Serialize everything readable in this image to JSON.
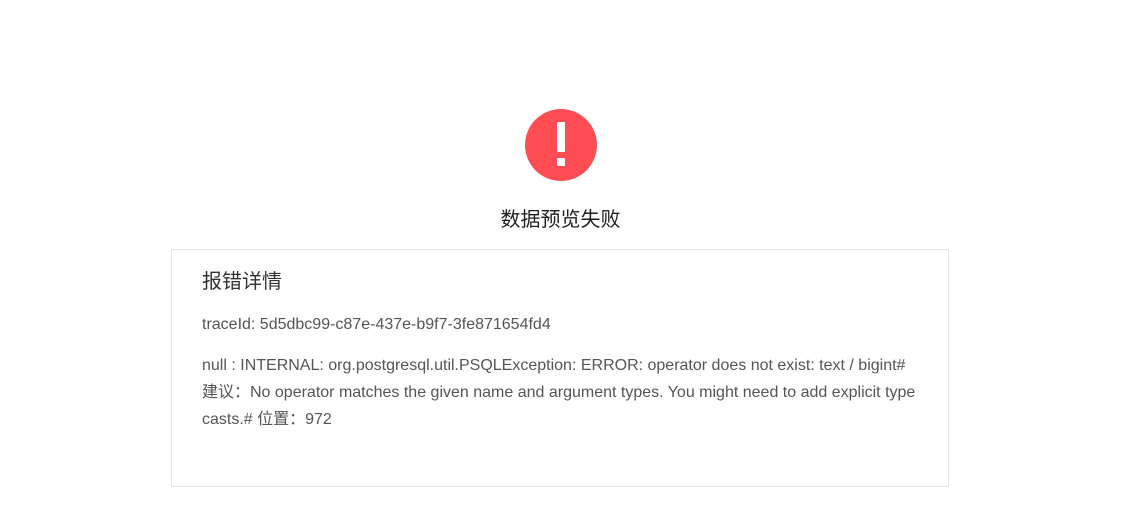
{
  "icon": {
    "name": "exclamation-icon",
    "color": "#ff4d54"
  },
  "title": "数据预览失败",
  "details": {
    "heading": "报错详情",
    "trace_id": "traceId: 5d5dbc99-c87e-437e-b9f7-3fe871654fd4",
    "message": "null : INTERNAL: org.postgresql.util.PSQLException: ERROR: operator does not exist: text / bigint# 建议：No operator matches the given name and argument types. You might need to add explicit type casts.# 位置：972"
  }
}
